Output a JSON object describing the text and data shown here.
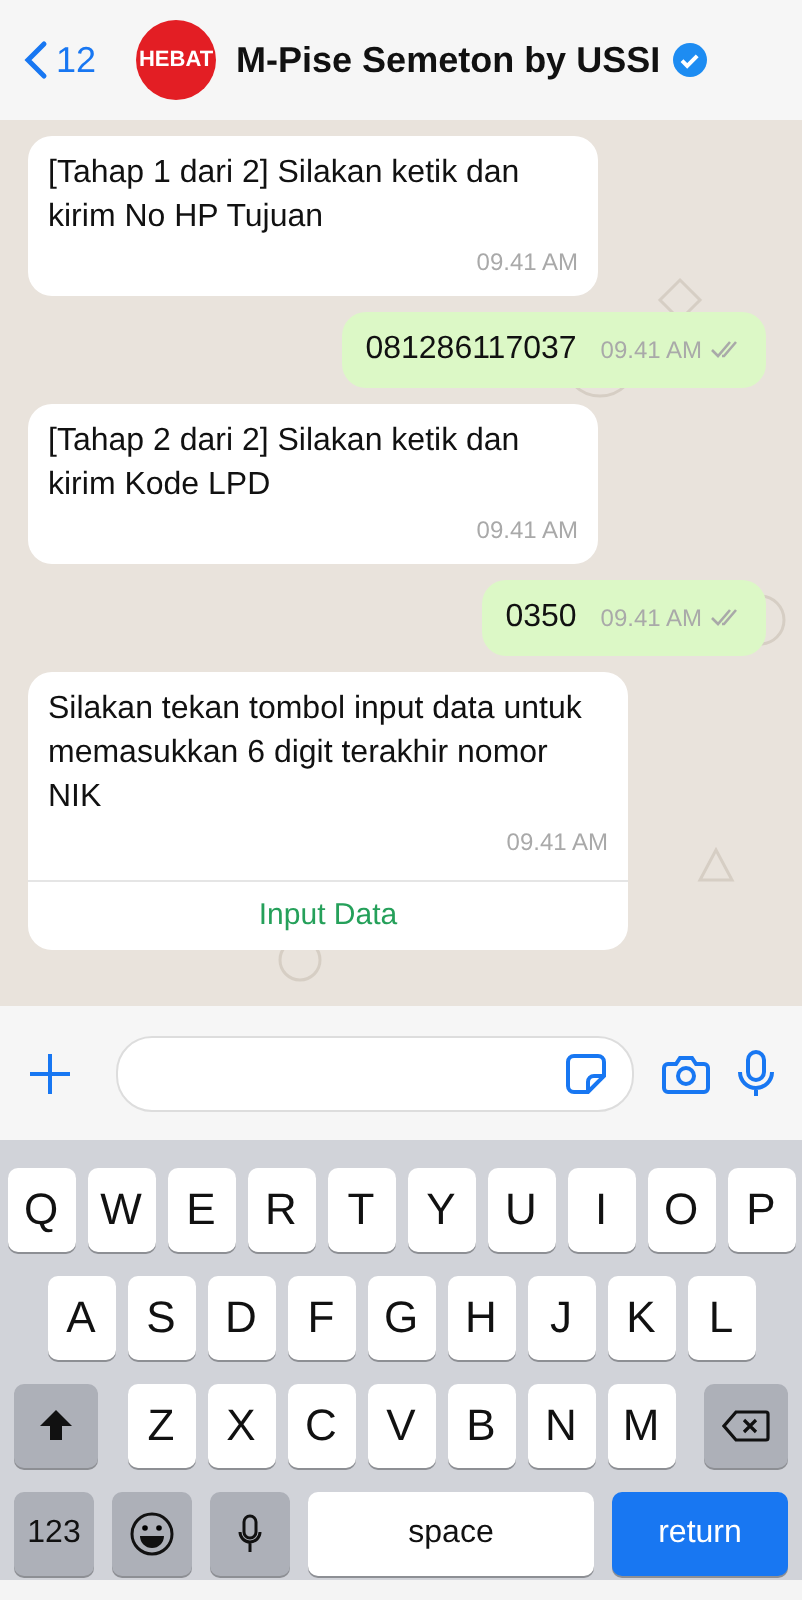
{
  "header": {
    "back_count": "12",
    "avatar_text": "HEBAT",
    "title": "M-Pise Semeton by USSI",
    "verified": true
  },
  "messages": [
    {
      "kind": "in",
      "text": "[Tahap 1 dari 2] Silakan ketik dan kirim No HP Tujuan",
      "time": "09.41 AM"
    },
    {
      "kind": "out",
      "text": "081286117037",
      "time": "09.41 AM"
    },
    {
      "kind": "in",
      "text": "[Tahap 2 dari 2] Silakan ketik dan kirim Kode LPD",
      "time": "09.41 AM"
    },
    {
      "kind": "out",
      "text": "0350",
      "time": "09.41 AM"
    },
    {
      "kind": "in",
      "text": "Silakan tekan tombol input data untuk memasukkan 6 digit terakhir nomor NIK",
      "time": "09.41 AM",
      "action": "Input Data"
    }
  ],
  "keyboard": {
    "rows": [
      [
        "Q",
        "W",
        "E",
        "R",
        "T",
        "Y",
        "U",
        "I",
        "O",
        "P"
      ],
      [
        "A",
        "S",
        "D",
        "F",
        "G",
        "H",
        "J",
        "K",
        "L"
      ],
      [
        "Z",
        "X",
        "C",
        "V",
        "B",
        "N",
        "M"
      ]
    ],
    "numbers_key": "123",
    "space_key": "space",
    "return_key": "return"
  }
}
